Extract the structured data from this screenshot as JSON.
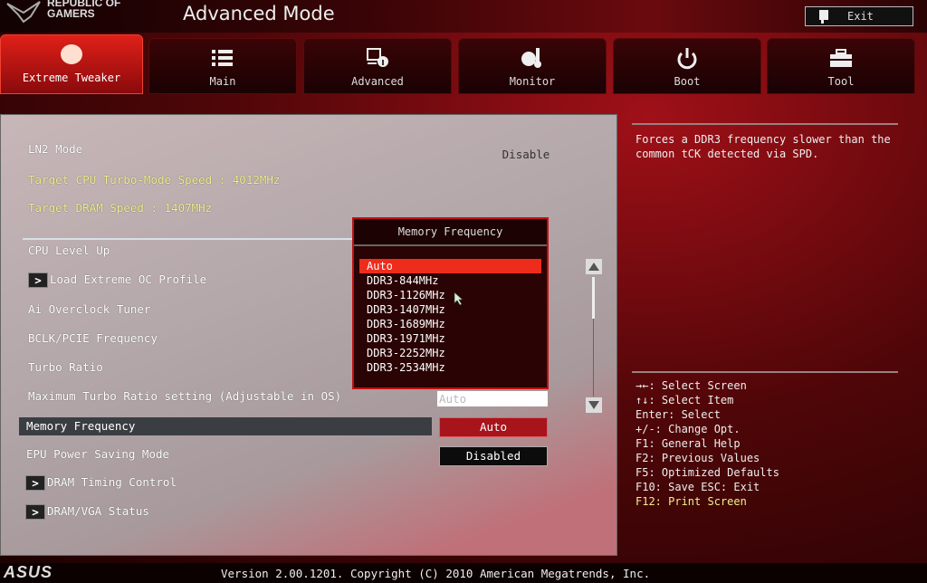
{
  "header": {
    "logo": "REPUBLIC OF GAMERS",
    "logo_line1": "REPUBLIC OF",
    "logo_line2": "GAMERS",
    "title": "Advanced Mode",
    "exit_label": "Exit"
  },
  "tabs": [
    {
      "label": "Extreme Tweaker",
      "icon": "tweaker-icon",
      "active": true
    },
    {
      "label": "Main",
      "icon": "list-icon"
    },
    {
      "label": "Advanced",
      "icon": "advanced-info-icon"
    },
    {
      "label": "Monitor",
      "icon": "thermometer-icon"
    },
    {
      "label": "Boot",
      "icon": "power-icon"
    },
    {
      "label": "Tool",
      "icon": "toolbox-icon"
    }
  ],
  "settings": {
    "ln2_mode": {
      "label": "LN2 Mode",
      "value": "Disable"
    },
    "target_cpu": "Target CPU Turbo-Mode Speed : 4012MHz",
    "target_dram": "Target DRAM Speed : 1407MHz",
    "items": [
      "CPU Level Up",
      "Load Extreme OC Profile",
      "Ai Overclock Tuner",
      "BCLK/PCIE Frequency",
      "Turbo Ratio",
      "Maximum Turbo Ratio setting (Adjustable in OS)",
      "Memory Frequency",
      "EPU Power Saving Mode",
      "DRAM Timing Control",
      "DRAM/VGA Status"
    ],
    "max_turbo_value": "Auto",
    "memory_frequency_value": "Auto",
    "epu_value": "Disabled"
  },
  "popup": {
    "title": "Memory Frequency",
    "options": [
      "Auto",
      "DDR3-844MHz",
      "DDR3-1126MHz",
      "DDR3-1407MHz",
      "DDR3-1689MHz",
      "DDR3-1971MHz",
      "DDR3-2252MHz",
      "DDR3-2534MHz"
    ],
    "selected": "Auto"
  },
  "help": {
    "text": "Forces a DDR3 frequency slower than the common tCK detected via SPD."
  },
  "keys": [
    "→←: Select Screen",
    "↑↓: Select Item",
    "Enter: Select",
    "+/-: Change Opt.",
    "F1: General Help",
    "F2: Previous Values",
    "F5: Optimized Defaults",
    "F10: Save  ESC: Exit",
    "F12: Print Screen"
  ],
  "footer": {
    "brand": "ASUS",
    "version": "Version 2.00.1201. Copyright (C) 2010 American Megatrends, Inc."
  },
  "colors": {
    "accent": "#ee2c1c",
    "highlight_text": "#f0f090"
  }
}
